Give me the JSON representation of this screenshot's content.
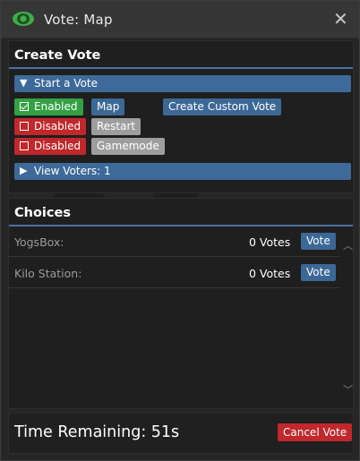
{
  "window": {
    "title": "Vote: Map",
    "close_glyph": "✕",
    "icon": "eye-icon"
  },
  "create_vote": {
    "heading": "Create Vote",
    "start_vote_label": "Start a Vote",
    "options": [
      {
        "status": "Enabled",
        "status_color": "#33a143",
        "name": "Map"
      },
      {
        "status": "Disabled",
        "status_color": "#c0282b",
        "name": "Restart"
      },
      {
        "status": "Disabled",
        "status_color": "#c0282b",
        "name": "Gamemode"
      }
    ],
    "custom_vote_label": "Create Custom Vote",
    "view_voters_label": "View Voters: 1"
  },
  "choices": {
    "heading": "Choices",
    "items": [
      {
        "name": "YogsBox:",
        "votes": "0 Votes",
        "vote_label": "Vote"
      },
      {
        "name": "Kilo Station:",
        "votes": "0 Votes",
        "vote_label": "Vote"
      }
    ]
  },
  "footer": {
    "time_remaining": "Time Remaining: 51s",
    "cancel_label": "Cancel Vote"
  },
  "colors": {
    "accent": "#4972a1",
    "button_blue": "#3c6896",
    "cancel_red": "#c0282b",
    "eye_green": "#3fae49"
  }
}
